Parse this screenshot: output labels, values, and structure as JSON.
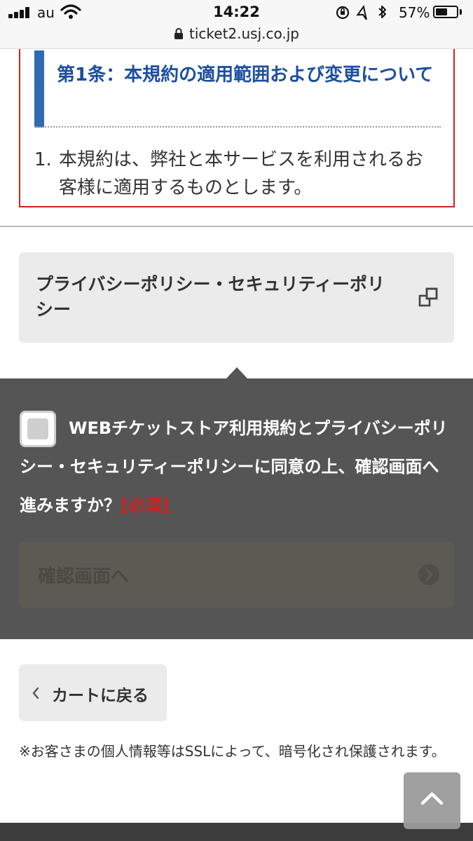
{
  "status_bar": {
    "carrier": "au",
    "time": "14:22",
    "battery_percent": "57%",
    "battery_level": 0.57,
    "url": "ticket2.usj.co.jp"
  },
  "terms": {
    "article_title": "第1条：本規約の適用範囲および変更について",
    "item_number": "1.",
    "item_text": "本規約は、弊社と本サービスを利用されるお客様に適用するものとします。"
  },
  "privacy_link": {
    "label": "プライバシーポリシー・セキュリティーポリシー",
    "icon": "external-link-icon"
  },
  "agreement": {
    "checkbox_checked": false,
    "question": "WEBチケットストア利用規約とプライバシーポリシー・セキュリティーポリシーに同意の上、確認画面へ進みますか？",
    "required_label": "[必須]",
    "confirm_button": "確認画面へ",
    "confirm_enabled": false
  },
  "back_button": {
    "label": "カートに戻る"
  },
  "ssl_note": "※お客さまの個人情報等はSSLによって、暗号化され保護されます。",
  "colors": {
    "accent_blue": "#1d4ea0",
    "required_red": "#d0211c",
    "panel_gray": "#555555"
  }
}
